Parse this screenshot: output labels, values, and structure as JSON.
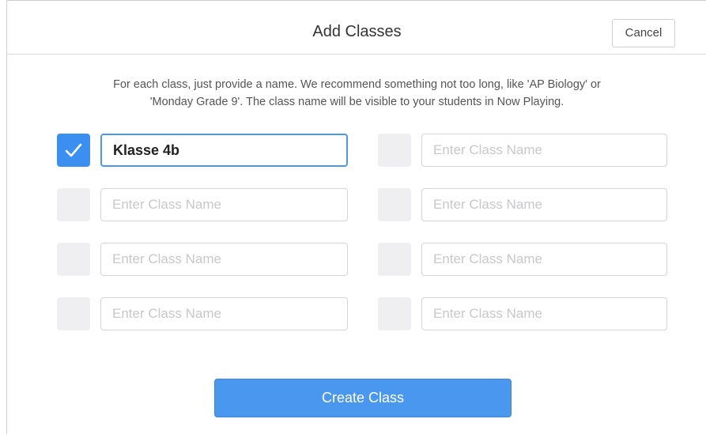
{
  "dialog": {
    "title": "Add Classes",
    "cancel_label": "Cancel",
    "instructions_line1": "For each class, just provide a name. We recommend something not too long, like 'AP Biology' or",
    "instructions_line2": "'Monday Grade 9'. The class name will be visible to your students in Now Playing.",
    "create_label": "Create Class"
  },
  "classes": [
    {
      "checked": true,
      "value": "Klasse 4b",
      "placeholder": "Enter Class Name"
    },
    {
      "checked": false,
      "value": "",
      "placeholder": "Enter Class Name"
    },
    {
      "checked": false,
      "value": "",
      "placeholder": "Enter Class Name"
    },
    {
      "checked": false,
      "value": "",
      "placeholder": "Enter Class Name"
    },
    {
      "checked": false,
      "value": "",
      "placeholder": "Enter Class Name"
    },
    {
      "checked": false,
      "value": "",
      "placeholder": "Enter Class Name"
    },
    {
      "checked": false,
      "value": "",
      "placeholder": "Enter Class Name"
    },
    {
      "checked": false,
      "value": "",
      "placeholder": "Enter Class Name"
    }
  ],
  "colors": {
    "accent": "#4a97ef",
    "checkbox_off": "#efeff1"
  },
  "icons": {
    "check": "checkmark-icon"
  }
}
